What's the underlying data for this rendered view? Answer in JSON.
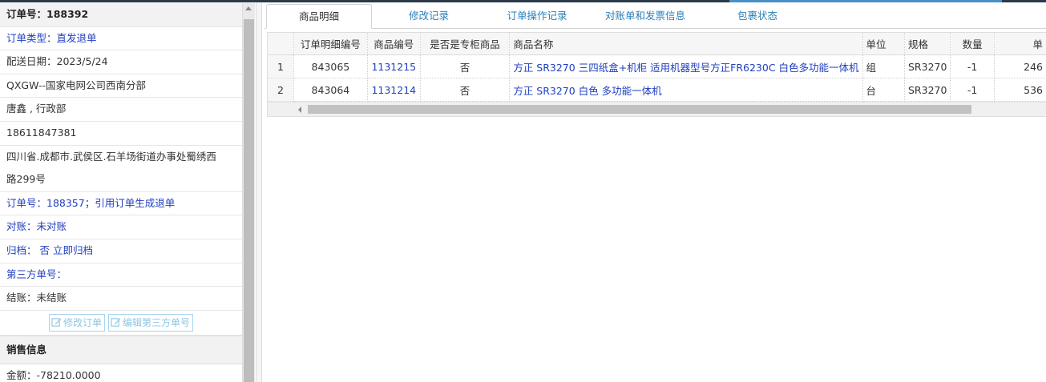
{
  "order": {
    "title": "订单号：188392",
    "type_label": "订单类型：",
    "type_value": "直发退单",
    "delivery_date": "配送日期：2023/5/24",
    "customer": "QXGW--国家电网公司西南分部",
    "contact": "唐鑫 , 行政部",
    "phone": "18611847381",
    "address_line1": "四川省.成都市.武侯区.石羊场街道办事处蜀绣西",
    "address_line2": "路299号",
    "ref_order": "订单号：188357；引用订单生成退单",
    "reconcile_label": "对账：",
    "reconcile_value": "未对账",
    "archive_label": "归档：",
    "archive_value": "否",
    "archive_action": "立即归档",
    "third_party_label": "第三方单号：",
    "settle_label": "结账：",
    "settle_value": "未结账",
    "btn_edit_order": "修改订单",
    "btn_edit_third": "编辑第三方单号"
  },
  "sales": {
    "title": "销售信息",
    "amount": "金额：-78210.0000"
  },
  "tabs": [
    "商品明细",
    "修改记录",
    "订单操作记录",
    "对账单和发票信息",
    "包裹状态"
  ],
  "grid": {
    "headers": [
      "订单明细编号",
      "商品编号",
      "是否是专柜商品",
      "商品名称",
      "单位",
      "规格",
      "数量",
      "单"
    ],
    "rows": [
      {
        "rn": "1",
        "detail_id": "843065",
        "item_id": "1131215",
        "counter": "否",
        "name": "方正 SR3270 三四纸盒+机柜 适用机器型号方正FR6230C 白色多功能一体机",
        "unit": "组",
        "spec": "SR3270",
        "qty": "-1",
        "price": "246"
      },
      {
        "rn": "2",
        "detail_id": "843064",
        "item_id": "1131214",
        "counter": "否",
        "name": "方正 SR3270 白色 多功能一体机",
        "unit": "台",
        "spec": "SR3270",
        "qty": "-1",
        "price": "536"
      }
    ]
  }
}
